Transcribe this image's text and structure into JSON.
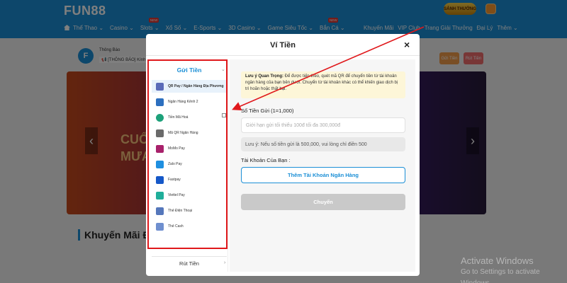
{
  "header": {
    "logo": "FUN88",
    "sanh_badge": "SẢNH THƯỞNG",
    "nav": [
      {
        "label": "Thể Thao ⌄",
        "new": ""
      },
      {
        "label": "Casino ⌄",
        "new": ""
      },
      {
        "label": "Slots ⌄",
        "new": "NEW"
      },
      {
        "label": "Xổ Số ⌄",
        "new": ""
      },
      {
        "label": "E-Sports ⌄",
        "new": ""
      },
      {
        "label": "3D Casino ⌄",
        "new": ""
      },
      {
        "label": "Game Siêu Tốc ⌄",
        "new": ""
      },
      {
        "label": "Bắn Cá ⌄",
        "new": "NEW"
      }
    ],
    "nav_right": [
      "Khuyến Mãi",
      "VIP Club",
      "Trang Giải Thưởng",
      "Đại Lý",
      "Thêm ⌄"
    ]
  },
  "background": {
    "notice_avatar": "F",
    "notice_title": "Thông Báo",
    "notice_text": "📢 [THÔNG BÁO] Kính...",
    "banner_text_1": "CUỐ",
    "banner_text_2": "MƯA",
    "promo_title": "Khuyến Mãi Đề X",
    "btn_1": "Gửi Tiền",
    "btn_2": "Rút Tiền"
  },
  "watermark": {
    "line1": "Activate Windows",
    "line2": "Go to Settings to activate Windows."
  },
  "modal": {
    "title": "Ví Tiền",
    "close": "×",
    "side_head": "Gửi Tiền",
    "side_chevron": "⌄",
    "pay_methods": [
      {
        "label": "QR Pay / Ngân Hàng Địa Phương",
        "color": "#5a6bb8",
        "active": true
      },
      {
        "label": "Ngân Hàng Kênh 2",
        "color": "#2c6fbf",
        "active": false
      },
      {
        "label": "Tiền Mã Hoá",
        "color": "#1da17a",
        "active": false
      },
      {
        "label": "Mã QR Ngân Hàng",
        "color": "#6a6a6a",
        "active": false
      },
      {
        "label": "MoMo Pay",
        "color": "#a8216b",
        "active": false
      },
      {
        "label": "Zalo Pay",
        "color": "#1f8fe0",
        "active": false
      },
      {
        "label": "Fastpay",
        "color": "#1558c8",
        "active": false
      },
      {
        "label": "Viettel Pay",
        "color": "#1fae9a",
        "active": false
      },
      {
        "label": "Thẻ Điện Thoại",
        "color": "#5577bb",
        "active": false
      },
      {
        "label": "Thẻ Cash",
        "color": "#6f8fcf",
        "active": false
      }
    ],
    "withdraw": "Rút Tiền",
    "withdraw_chevron": "›",
    "note_bold": "Lưu ý Quan Trọng:",
    "note_text": " Để được tiếp theo, quét mã QR để chuyển tiền từ tài khoản ngân hàng của bạn bên dưới. Chuyển từ tài khoản khác có thể khiến giao dịch bị trì hoãn hoặc thất bại.",
    "amount_label": "Số Tiền Gửi (1=1,000)",
    "amount_placeholder": "Giới hạn gửi tối thiểu 100đ tối đa 300,000đ",
    "amount_hint": "Lưu ý: Nếu số tiền gửi là 500,000, vui lòng chỉ điền 500",
    "account_label": "Tài Khoản Của Bạn :",
    "add_account": "Thêm Tài Khoản Ngân Hàng",
    "submit": "Chuyển"
  }
}
